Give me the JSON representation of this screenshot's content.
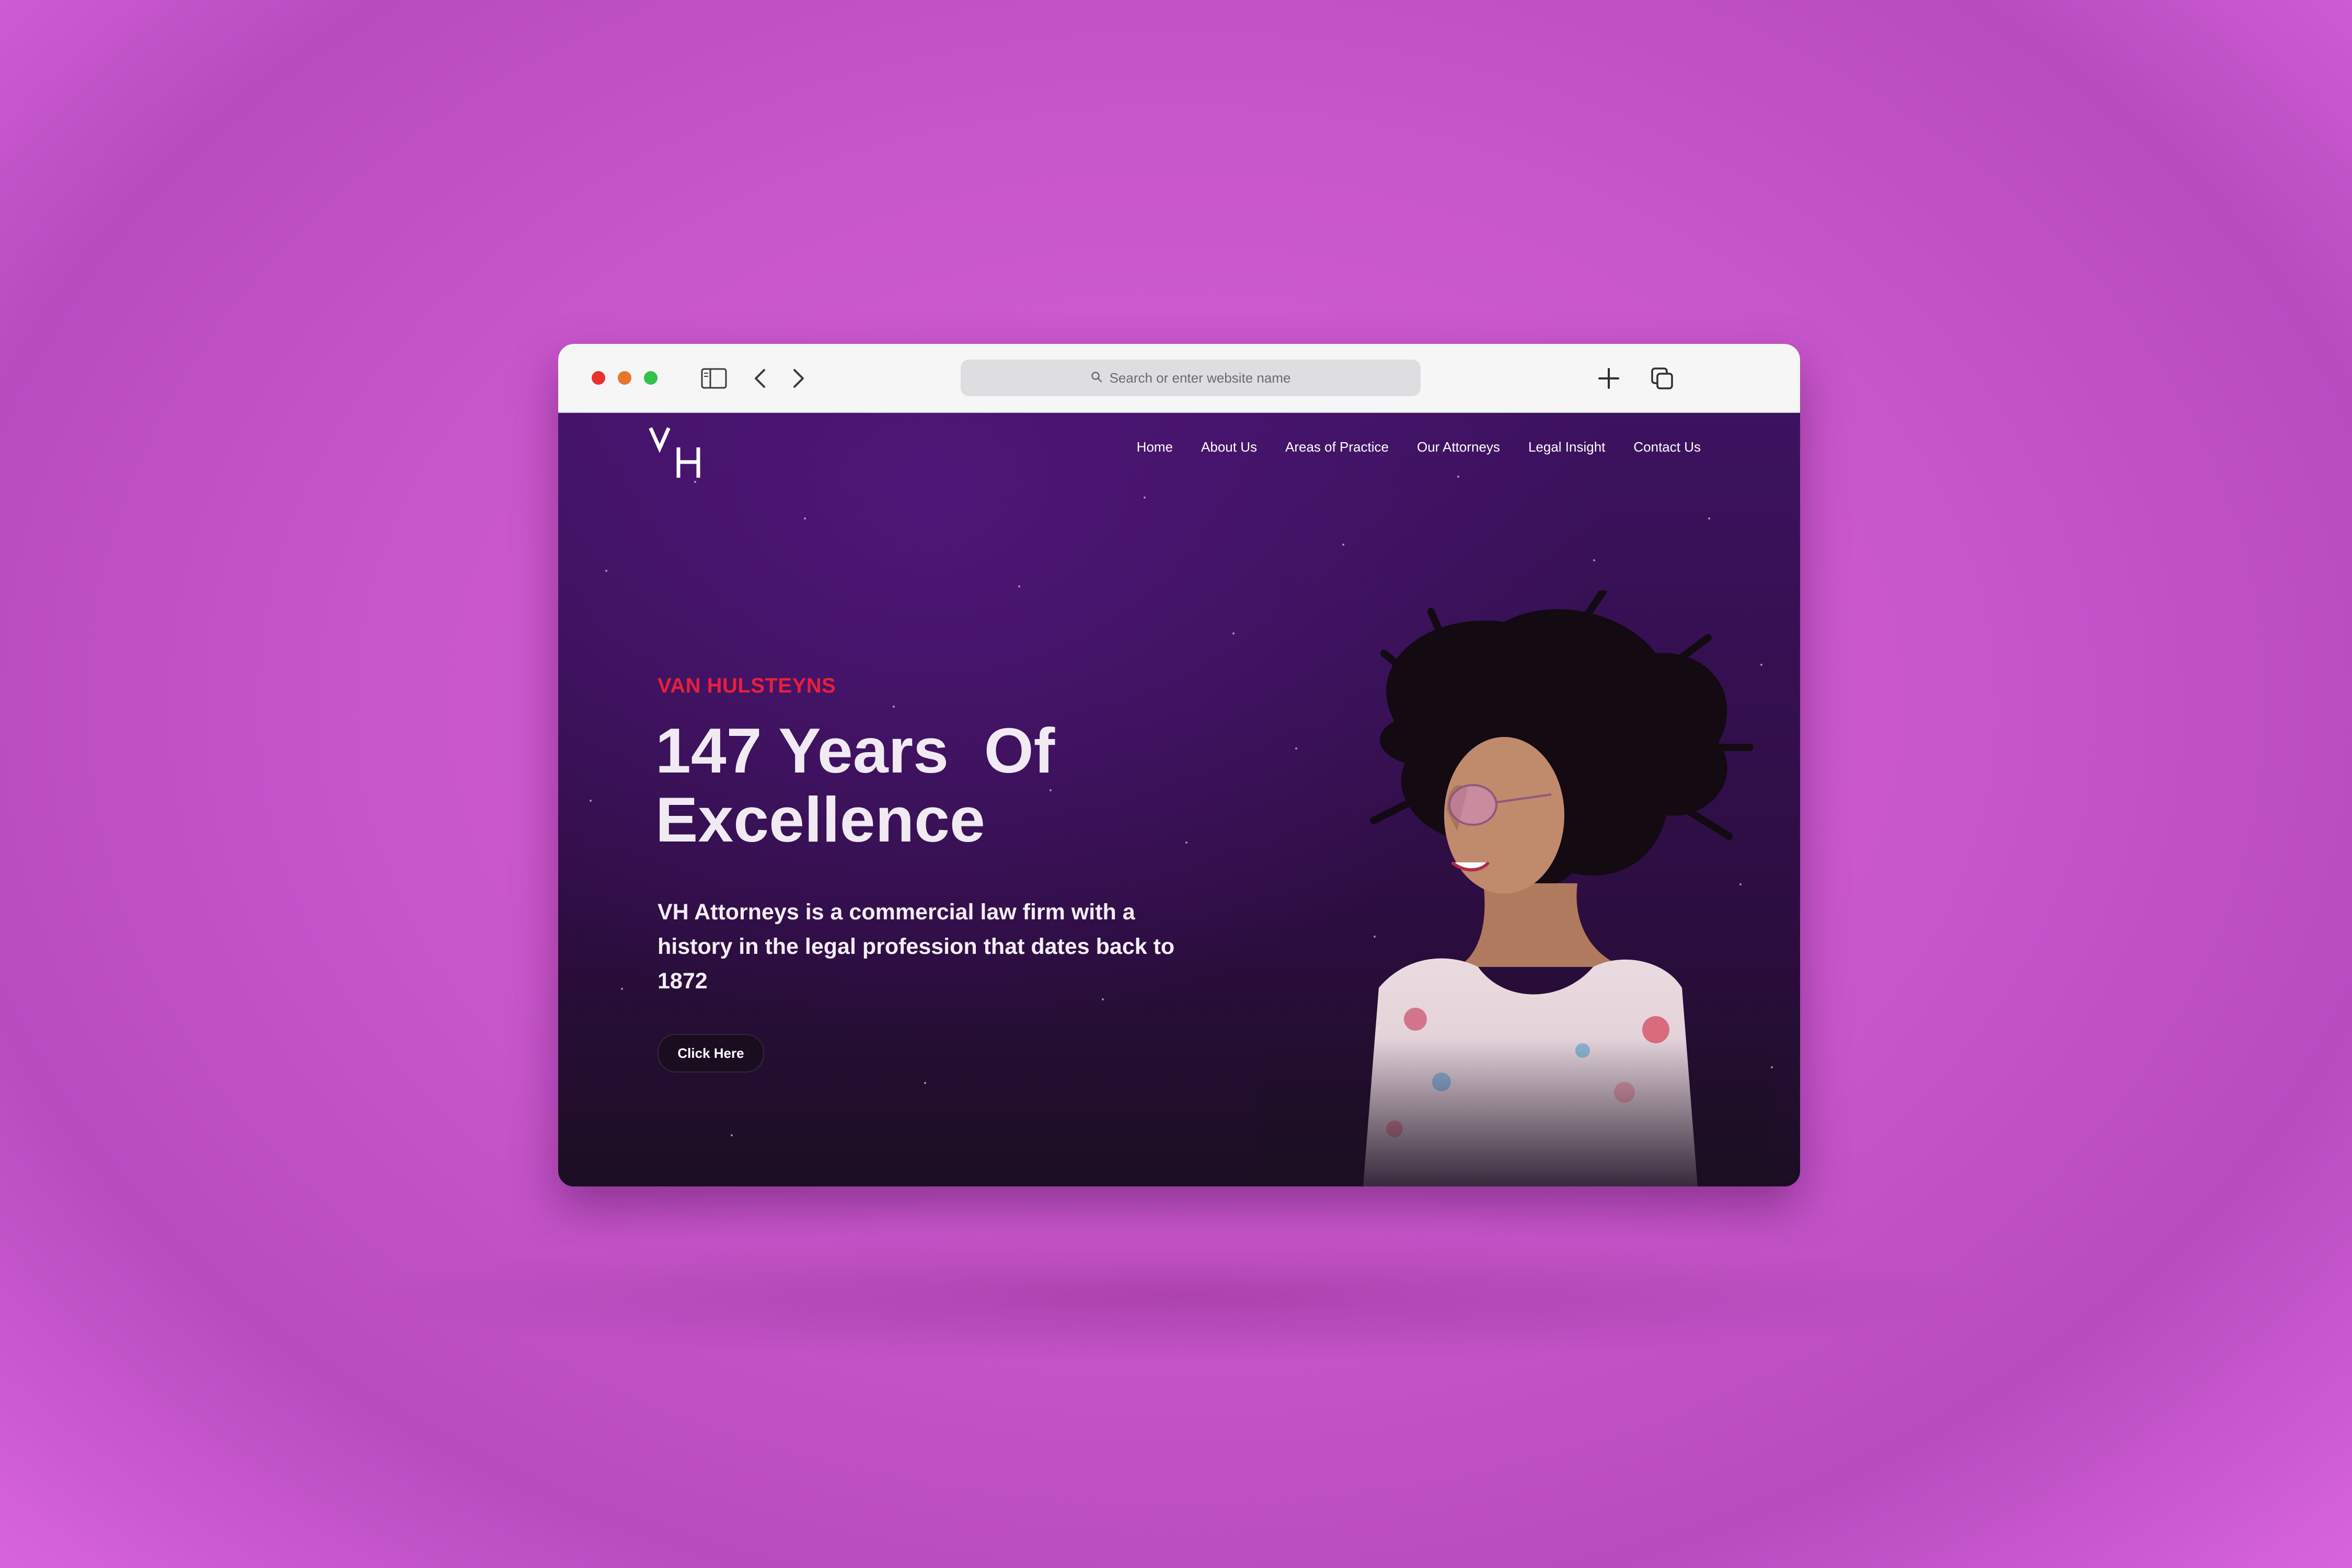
{
  "browser": {
    "url_placeholder": "Search or enter website name",
    "icons": [
      "close-dot",
      "minimize-dot",
      "zoom-dot",
      "sidebar-icon",
      "back-icon",
      "forward-icon",
      "search-icon",
      "new-tab-icon",
      "tabs-overview-icon"
    ]
  },
  "site": {
    "logo": "VH",
    "nav": [
      "Home",
      "About Us",
      "Areas of Practice",
      "Our Attorneys",
      "Legal Insight",
      "Contact Us"
    ]
  },
  "hero": {
    "eyebrow": "VAN HULSTEYNS",
    "headline_line1": "147 Years  Of",
    "headline_line2": "Excellence",
    "description": "VH Attorneys is a commercial law firm with a history in the legal profession that dates back to 1872",
    "cta_label": "Click Here"
  },
  "colors": {
    "background": "#c957cc",
    "hero_top": "#3d1260",
    "hero_bottom": "#1b0e22",
    "eyebrow": "#e81f3c",
    "headline": "#f1eaf3"
  }
}
